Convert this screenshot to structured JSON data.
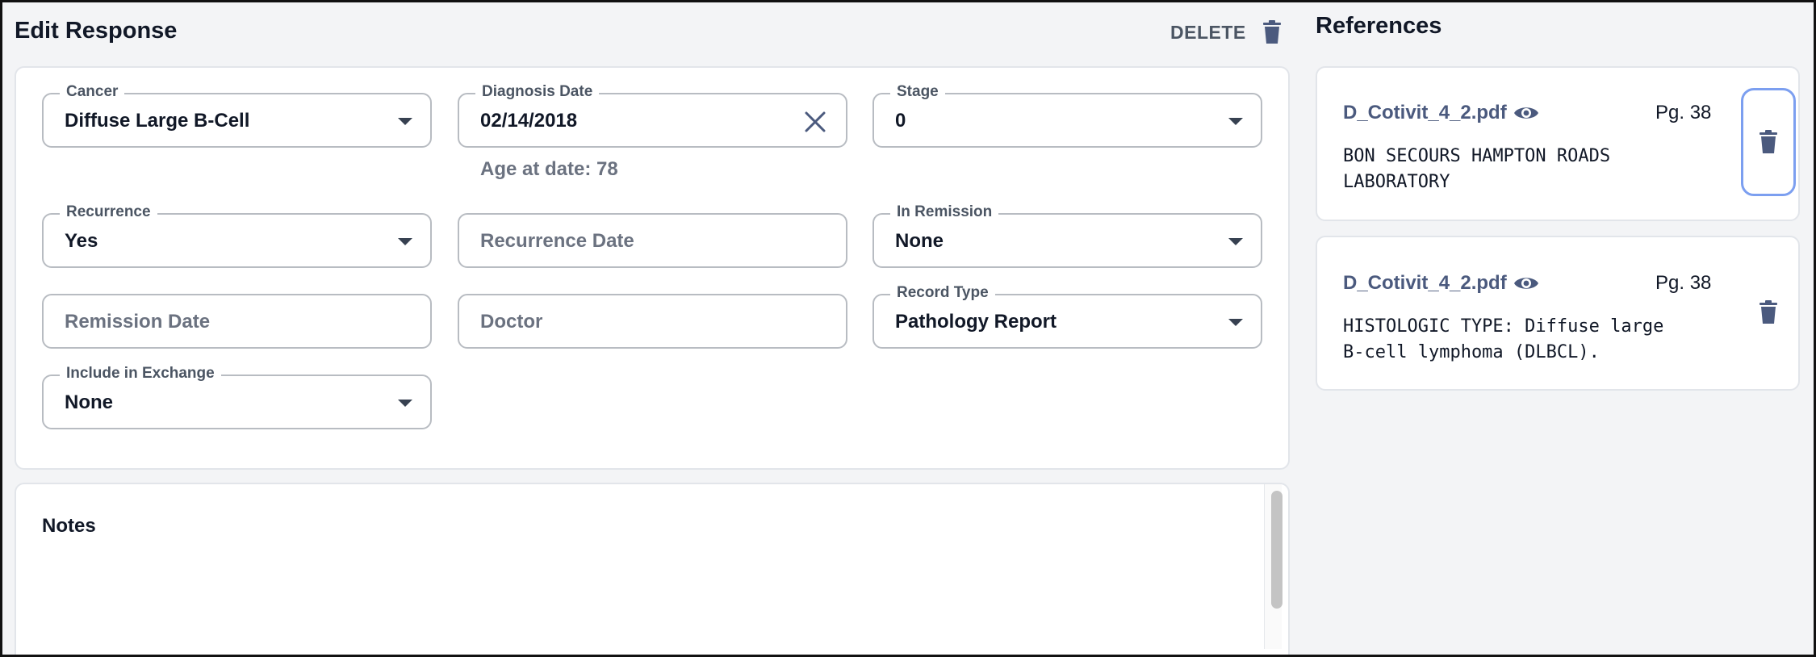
{
  "edit_panel": {
    "title": "Edit Response",
    "delete_label": "DELETE"
  },
  "fields": {
    "cancer": {
      "label": "Cancer",
      "value": "Diffuse Large B-Cell"
    },
    "diagnosis_date": {
      "label": "Diagnosis Date",
      "value": "02/14/2018"
    },
    "stage": {
      "label": "Stage",
      "value": "0"
    },
    "age_note": "Age at date: 78",
    "recurrence": {
      "label": "Recurrence",
      "value": "Yes"
    },
    "recurrence_date": {
      "placeholder": "Recurrence Date"
    },
    "in_remission": {
      "label": "In Remission",
      "value": "None"
    },
    "remission_date": {
      "placeholder": "Remission Date"
    },
    "doctor": {
      "placeholder": "Doctor"
    },
    "record_type": {
      "label": "Record Type",
      "value": "Pathology Report"
    },
    "include_in_exchange": {
      "label": "Include in Exchange",
      "value": "None"
    }
  },
  "notes": {
    "title": "Notes"
  },
  "references": {
    "title": "References",
    "items": [
      {
        "file": "D_Cotivit_4_2.pdf",
        "page": "Pg. 38",
        "text_lines": [
          "BON SECOURS HAMPTON ROADS",
          "LABORATORY"
        ]
      },
      {
        "file": "D_Cotivit_4_2.pdf",
        "page": "Pg. 38",
        "text_lines": [
          "HISTOLOGIC TYPE: Diffuse large",
          "B-cell lymphoma (DLBCL)."
        ]
      }
    ]
  },
  "icons": {
    "delete": "trash-icon",
    "view": "eye-icon",
    "clear": "close-icon",
    "dropdown": "caret-down-icon"
  },
  "colors": {
    "accent_link": "#4b5a7e",
    "icon": "#4b5a7e",
    "focus_ring": "#7c9ff0",
    "border": "#b8bcc2"
  }
}
